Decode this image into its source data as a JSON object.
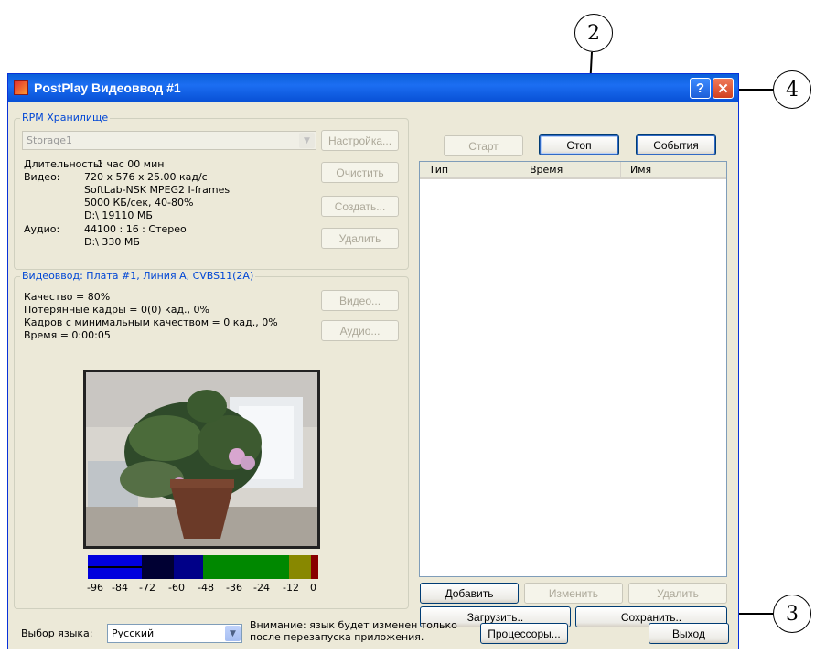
{
  "callouts": [
    "2",
    "4",
    "3"
  ],
  "window": {
    "title": "PostPlay Видеоввод #1",
    "help_label": "?",
    "close_label": "✕"
  },
  "storage": {
    "group_title": "RPM Хранилище",
    "selected": "Storage1",
    "details": {
      "duration_label": "Длительность:",
      "duration_value": "1 час 00 мин",
      "video_label": "Видео:",
      "video_line1": "720 x 576 x 25.00 кад/с",
      "video_line2": "SoftLab-NSK MPEG2 I-frames",
      "video_line3": "5000 КБ/сек, 40-80%",
      "video_line4": "D:\\ 19110 МБ",
      "audio_label": "Аудио:",
      "audio_line1": "44100 : 16 : Стерео",
      "audio_line2": "D:\\ 330 МБ"
    },
    "buttons": {
      "settings": "Настройка...",
      "clear": "Очистить",
      "create": "Создать...",
      "delete": "Удалить"
    }
  },
  "capture": {
    "group_title": "Видеоввод: Плата #1, Линия A, CVBS11(2A)",
    "quality": "Качество = 80%",
    "lost_frames": "Потерянные кадры = 0(0) кад., 0%",
    "min_quality_frames": "Кадров с минимальным качеством = 0 кад., 0%",
    "time": "Время = 0:00:05",
    "buttons": {
      "video": "Видео...",
      "audio": "Аудио..."
    },
    "meter_ticks": [
      "-96",
      "-84",
      "-72",
      "-60",
      "-48",
      "-36",
      "-24",
      "-12",
      "0"
    ]
  },
  "controls": {
    "start": "Старт",
    "stop": "Стоп",
    "events": "События"
  },
  "events_list": {
    "columns": [
      "Тип",
      "Время",
      "Имя"
    ]
  },
  "list_buttons": {
    "add": "Добавить",
    "edit": "Изменить",
    "delete": "Удалить",
    "load": "Загрузить..",
    "save": "Сохранить.."
  },
  "language": {
    "label": "Выбор языка:",
    "selected": "Русский",
    "note_line1": "Внимание: язык будет изменен только",
    "note_line2": "после перезапуска приложения."
  },
  "footer": {
    "processors": "Процессоры...",
    "exit": "Выход"
  },
  "colors": {
    "title_blue": "#0a5fd8",
    "group_title": "#0046d5",
    "close_red": "#e0482a"
  }
}
